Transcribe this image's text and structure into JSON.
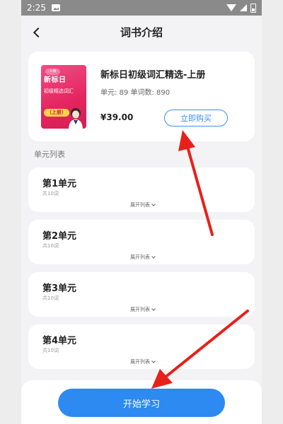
{
  "status_bar": {
    "time": "2:25",
    "icons": [
      "image-icon",
      "wifi-icon",
      "signal-icon",
      "battery-icon"
    ]
  },
  "nav": {
    "title": "词书介绍",
    "back_icon": "chevron-left-icon"
  },
  "book": {
    "cover_badge": "·人教·",
    "cover_title": "新标日",
    "cover_subtitle": "初级精选词汇",
    "cover_volume": "（上册）",
    "title": "新标日初级词汇精选-上册",
    "meta": "单元: 89  单词数: 890",
    "price": "¥39.00",
    "buy_label": "立即购买"
  },
  "units_section": {
    "title": "单元列表",
    "expand_label": "展开列表",
    "units": [
      {
        "name": "第1单元",
        "count": "共10词"
      },
      {
        "name": "第2单元",
        "count": "共10词"
      },
      {
        "name": "第3单元",
        "count": "共10词"
      },
      {
        "name": "第4单元",
        "count": "共10词"
      }
    ]
  },
  "bottom": {
    "start_label": "开始学习"
  },
  "colors": {
    "accent": "#2c8af0",
    "cover": "#e4245e",
    "annotation_arrow": "#e8201a"
  }
}
